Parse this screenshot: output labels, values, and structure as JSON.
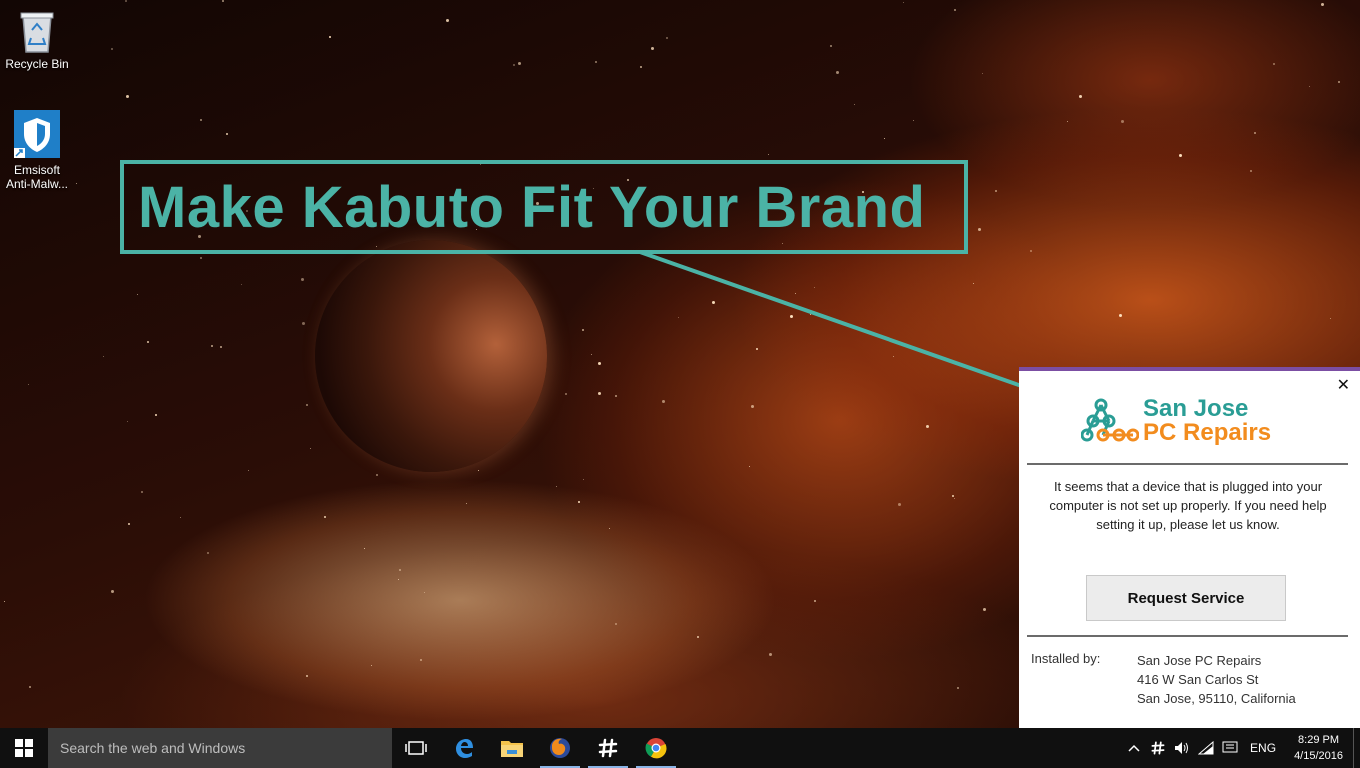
{
  "desktop": {
    "icons": [
      {
        "label": "Recycle Bin"
      },
      {
        "label": "Emsisoft Anti-Malw..."
      }
    ]
  },
  "callout": {
    "text": "Make Kabuto Fit Your Brand",
    "color": "#4bb3a6"
  },
  "popup": {
    "accent_color": "#7b4ea3",
    "close_glyph": "✕",
    "brand": {
      "line1": "San Jose",
      "line2": "PC Repairs",
      "line1_color": "#2a9d95",
      "line2_color": "#f28c1e"
    },
    "message": "It seems that a device that is plugged into your computer is not set up properly. If you need help setting it up, please let us know.",
    "button_label": "Request Service",
    "installed_by_label": "Installed by:",
    "installed_by_lines": [
      "San Jose PC Repairs",
      "416 W San Carlos St",
      "San Jose, 95110, California"
    ]
  },
  "taskbar": {
    "search_placeholder": "Search the web and Windows",
    "pinned_apps": [
      "task-view",
      "edge",
      "file-explorer",
      "firefox",
      "slack",
      "chrome"
    ],
    "tray": {
      "language": "ENG",
      "time": "8:29 PM",
      "date": "4/15/2016"
    }
  }
}
